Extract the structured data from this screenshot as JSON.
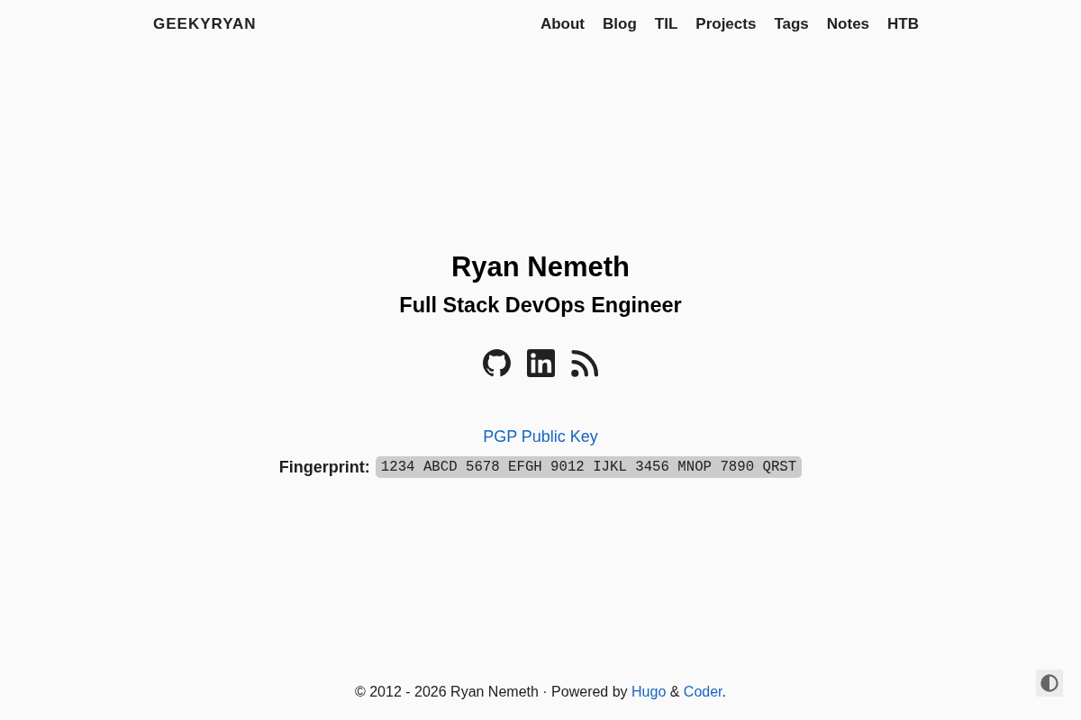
{
  "header": {
    "brand": "GEEKYRYAN",
    "nav": [
      "About",
      "Blog",
      "TIL",
      "Projects",
      "Tags",
      "Notes",
      "HTB"
    ]
  },
  "hero": {
    "name": "Ryan Nemeth",
    "title": "Full Stack DevOps Engineer",
    "social_links": [
      {
        "kind": "github"
      },
      {
        "kind": "linkedin"
      },
      {
        "kind": "rss"
      }
    ],
    "pgp_link": "PGP Public Key",
    "fingerprint": {
      "label": "Fingerprint:",
      "value": "1234 ABCD 5678 EFGH 9012 IJKL 3456 MNOP 7890 QRST"
    }
  },
  "footer": {
    "parts": [
      {
        "kind": "text",
        "text": "© 2012 - 2026 Ryan Nemeth · Powered by "
      },
      {
        "kind": "link",
        "text": "Hugo"
      },
      {
        "kind": "text",
        "text": " & "
      },
      {
        "kind": "link",
        "text": "Coder"
      },
      {
        "kind": "text",
        "text": "."
      }
    ]
  }
}
